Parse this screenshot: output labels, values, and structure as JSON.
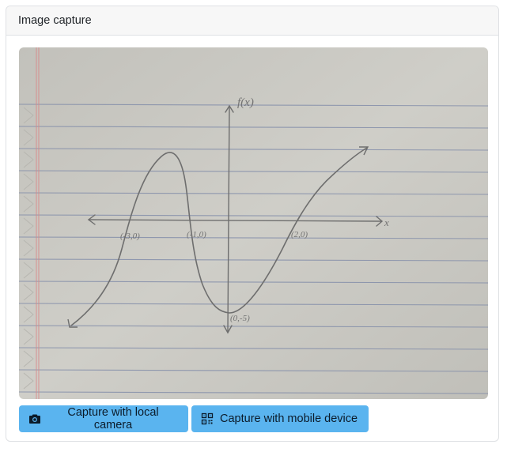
{
  "card": {
    "title": "Image capture"
  },
  "capture": {
    "axis_labels": {
      "y": "f(x)",
      "x": "x"
    },
    "points": [
      {
        "label": "(-3,0)"
      },
      {
        "label": "(-1,0)"
      },
      {
        "label": "(2,0)"
      },
      {
        "label": "(0,-5)"
      }
    ]
  },
  "buttons": {
    "local_camera": {
      "label": "Capture with local camera",
      "icon": "camera-icon"
    },
    "mobile_device": {
      "label": "Capture with mobile device",
      "icon": "qr-code-icon"
    }
  },
  "colors": {
    "button_bg": "#5ab4ef",
    "paper": "#c9c8c2",
    "rule_lines": "#7a86a6",
    "margin_line": "#d98a8a",
    "pencil": "#6e6e6e"
  }
}
